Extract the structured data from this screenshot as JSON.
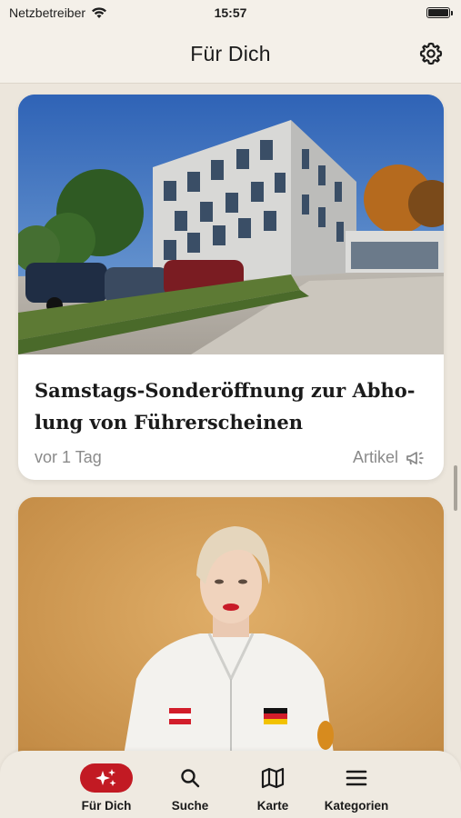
{
  "status_bar": {
    "carrier": "Netzbetreiber",
    "time": "15:57"
  },
  "header": {
    "title": "Für Dich"
  },
  "feed": {
    "cards": [
      {
        "headline": "Samstags-Sonderöffnung zur Abho-lung von Führerscheinen",
        "age": "vor 1 Tag",
        "type": "Artikel",
        "image": "modern office building with cars parked in front"
      },
      {
        "image": "blond person in white jacket with flag patches"
      }
    ]
  },
  "tabbar": {
    "items": [
      {
        "label": "Für Dich",
        "icon": "sparkles-icon",
        "active": true
      },
      {
        "label": "Suche",
        "icon": "search-icon",
        "active": false
      },
      {
        "label": "Karte",
        "icon": "map-icon",
        "active": false
      },
      {
        "label": "Kategorien",
        "icon": "menu-icon",
        "active": false
      }
    ]
  },
  "colors": {
    "accent": "#c21a23",
    "background": "#ece6dc",
    "bar": "#f4f0e9"
  }
}
